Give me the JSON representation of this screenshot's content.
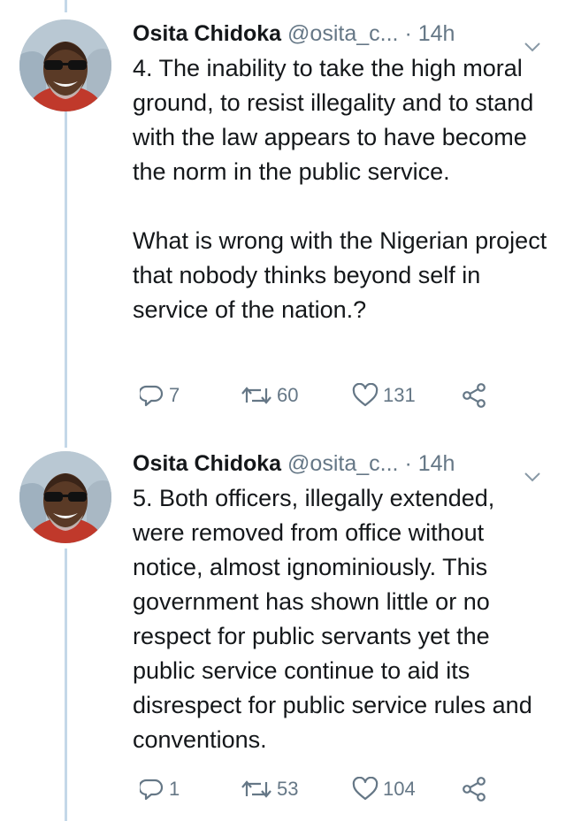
{
  "tweets": [
    {
      "name": "Osita Chidoka",
      "handle": "@osita_c...",
      "dot": "·",
      "time": "14h",
      "paragraphs": [
        "4. The inability to take the high moral ground, to resist illegality and to stand with the law appears to have become the norm in the public service.",
        "What is wrong with the Nigerian project that nobody thinks beyond self in service of the nation.?"
      ],
      "replies": "7",
      "retweets": "60",
      "likes": "131"
    },
    {
      "name": "Osita Chidoka",
      "handle": "@osita_c...",
      "dot": "·",
      "time": "14h",
      "paragraphs": [
        "5. Both officers, illegally extended, were removed from office without notice, almost ignominiously. This government has shown little or no respect for public servants yet the public service continue to aid its disrespect for public service rules and conventions."
      ],
      "replies": "1",
      "retweets": "53",
      "likes": "104"
    }
  ],
  "icons": {
    "avatar": "avatar-photo",
    "menu": "chevron-down-icon",
    "reply": "reply-icon",
    "retweet": "retweet-icon",
    "like": "heart-icon",
    "share": "share-icon"
  },
  "colors": {
    "text": "#14171a",
    "muted": "#657786",
    "thread_line": "#c4d8e8"
  }
}
